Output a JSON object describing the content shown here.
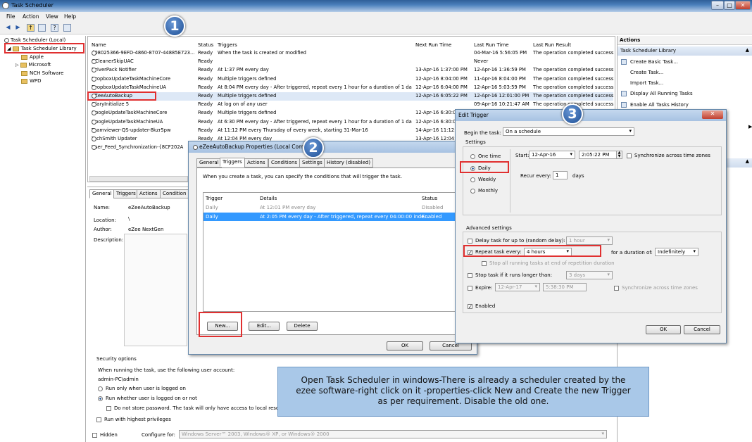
{
  "window": {
    "title": "Task Scheduler"
  },
  "menu": [
    "File",
    "Action",
    "View",
    "Help"
  ],
  "tree": {
    "root": "Task Scheduler (Local)",
    "library": "Task Scheduler Library",
    "children": [
      "Apple",
      "Microsoft",
      "NCH Software",
      "WPD"
    ]
  },
  "tasklist": {
    "headers": [
      "Name",
      "Status",
      "Triggers",
      "Next Run Time",
      "Last Run Time",
      "Last Run Result"
    ],
    "rows": [
      [
        "{08025366-9EFD-4860-8707-44885E723...",
        "Ready",
        "When the task is created or modified",
        "",
        "04-Mar-16 5:56:05 PM",
        "The operation completed success"
      ],
      [
        "CCleanerSkipUAC",
        "Ready",
        "",
        "",
        "Never",
        ""
      ],
      [
        "DriverPack Notifier",
        "Ready",
        "At 1:37 PM every day",
        "13-Apr-16 1:37:00 PM",
        "12-Apr-16 1:36:59 PM",
        "The operation completed success"
      ],
      [
        "DropboxUpdateTaskMachineCore",
        "Ready",
        "Multiple triggers defined",
        "12-Apr-16 8:04:00 PM",
        "11-Apr-16 8:04:00 PM",
        "The operation completed success"
      ],
      [
        "DropboxUpdateTaskMachineUA",
        "Ready",
        "At 8:04 PM every day - After triggered, repeat every 1 hour for a duration of 1 day.",
        "12-Apr-16 6:04:00 PM",
        "12-Apr-16 5:03:59 PM",
        "The operation completed success"
      ],
      [
        "eZeeAutoBackup",
        "Ready",
        "Multiple triggers defined",
        "12-Apr-16 6:05:22 PM",
        "12-Apr-16 12:01:00 PM",
        "The operation completed success"
      ],
      [
        "GlaryInitialize 5",
        "Ready",
        "At log on of any user",
        "",
        "09-Apr-16 10:21:47 AM",
        "The operation completed success"
      ],
      [
        "GoogleUpdateTaskMachineCore",
        "Ready",
        "Multiple triggers defined",
        "12-Apr-16 6:30:00",
        "",
        ""
      ],
      [
        "GoogleUpdateTaskMachineUA",
        "Ready",
        "At 6:30 PM every day - After triggered, repeat every 1 hour for a duration of 1 day.",
        "12-Apr-16 6:30:00",
        "",
        ""
      ],
      [
        "Teamviewer-QS-updater-8kzr5pw",
        "Ready",
        "At 11:12 PM every Thursday of every week, starting 31-Mar-16",
        "14-Apr-16 11:12:0",
        "",
        ""
      ],
      [
        "TechSmith Updater",
        "Ready",
        "At 12:04 PM every day",
        "13-Apr-16 12:04:0",
        "",
        ""
      ],
      [
        "User_Feed_Synchronization-{8CF202A",
        "",
        "",
        "",
        "",
        ""
      ]
    ]
  },
  "actions": {
    "header": "Actions",
    "section": "Task Scheduler Library",
    "items": [
      "Create Basic Task...",
      "Create Task...",
      "Import Task...",
      "Display All Running Tasks",
      "Enable All Tasks History"
    ]
  },
  "detail": {
    "tabs": [
      "General",
      "Triggers",
      "Actions",
      "Condition"
    ],
    "name_label": "Name:",
    "name": "eZeeAutoBackup",
    "location_label": "Location:",
    "location": "\\",
    "author_label": "Author:",
    "author": "eZee NextGen",
    "desc_label": "Description:",
    "security_title": "Security options",
    "account_text": "When running the task, use the following user account:",
    "account": "admin-PC\\admin",
    "opt1": "Run only when user is logged on",
    "opt2": "Run whether user is logged on or not",
    "opt3": "Do not store password. The task will only have access to local resou",
    "opt4": "Run with highest privileges",
    "hidden": "Hidden",
    "configure_label": "Configure for:",
    "configure_value": "Windows Server™ 2003, Windows® XP, or Windows® 2000"
  },
  "props": {
    "title": "eZeeAutoBackup Properties (Local Comput",
    "tabs": [
      "General",
      "Triggers",
      "Actions",
      "Conditions",
      "Settings",
      "History (disabled)"
    ],
    "intro": "When you create a task, you can specify the conditions that will trigger the task.",
    "headers": [
      "Trigger",
      "Details",
      "Status"
    ],
    "rows": [
      [
        "Daily",
        "At 12:01 PM every day",
        "Disabled"
      ],
      [
        "Daily",
        "At 2:05 PM every day - After triggered, repeat every 04:00:00 inde...",
        "Enabled"
      ]
    ],
    "new": "New...",
    "edit": "Edit...",
    "delete": "Delete",
    "ok": "OK",
    "cancel": "Cancel"
  },
  "edit": {
    "title": "Edit Trigger",
    "begin_label": "Begin the task:",
    "begin_value": "On a schedule",
    "settings_label": "Settings",
    "schedule": [
      "One time",
      "Daily",
      "Weekly",
      "Monthly"
    ],
    "start_label": "Start:",
    "start_date": "12-Apr-16",
    "start_time": "2:05:22 PM",
    "sync": "Synchronize across time zones",
    "recur_label": "Recur every:",
    "recur_value": "1",
    "recur_unit": "days",
    "advanced": "Advanced settings",
    "delay_label": "Delay task for up to (random delay):",
    "delay_value": "1 hour",
    "repeat_label": "Repeat task every:",
    "repeat_value": "4 hours",
    "duration_label": "for a duration of:",
    "duration_value": "Indefinitely",
    "stop_all": "Stop all running tasks at end of repetition duration",
    "stop_if": "Stop task if it runs longer than:",
    "stop_value": "3 days",
    "expire_label": "Expire:",
    "expire_date": "12-Apr-17",
    "expire_time": "5:38:30 PM",
    "expire_sync": "Synchronize across time zones",
    "enabled": "Enabled",
    "ok": "OK",
    "cancel": "Cancel"
  },
  "badges": [
    "1",
    "2",
    "3"
  ],
  "callout": "Open Task Scheduler in windows-There is already a scheduler created by the ezee software-right click on it -properties-click New and Create the new Trigger as per requirement. Disable the old one."
}
